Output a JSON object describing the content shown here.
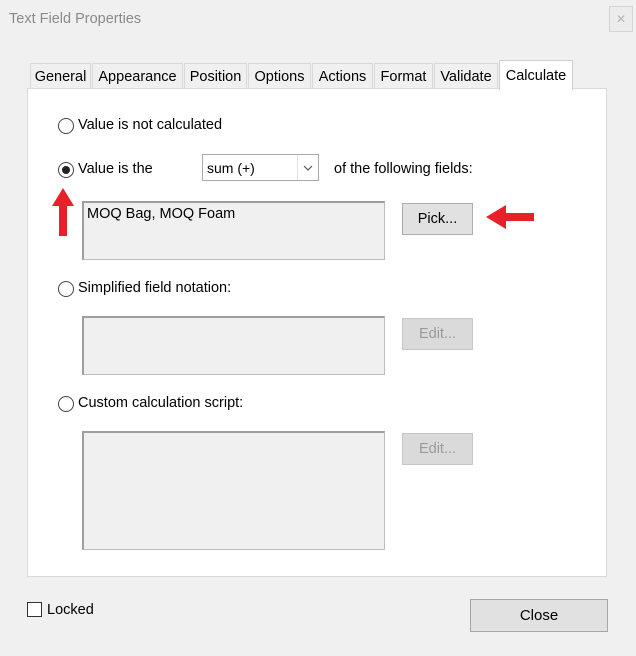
{
  "window": {
    "title": "Text Field Properties",
    "close_glyph": "✕"
  },
  "tabs": [
    {
      "label": "General"
    },
    {
      "label": "Appearance"
    },
    {
      "label": "Position"
    },
    {
      "label": "Options"
    },
    {
      "label": "Actions"
    },
    {
      "label": "Format"
    },
    {
      "label": "Validate"
    },
    {
      "label": "Calculate",
      "active": true
    }
  ],
  "calculate": {
    "not_calculated_label": "Value is not calculated",
    "value_is_label": "Value is the",
    "operation": {
      "selected": "sum (+)",
      "chevron": "⌄"
    },
    "following_fields_label": "of the following fields:",
    "fields_value": "MOQ Bag, MOQ Foam",
    "pick_label": "Pick...",
    "simplified_label": "Simplified field notation:",
    "simplified_edit_label": "Edit...",
    "custom_label": "Custom calculation script:",
    "custom_edit_label": "Edit...",
    "selected_option": "value-is"
  },
  "footer": {
    "locked_label": "Locked",
    "locked_checked": false,
    "close_label": "Close"
  },
  "colors": {
    "annotation_arrow": "#e8202a"
  }
}
